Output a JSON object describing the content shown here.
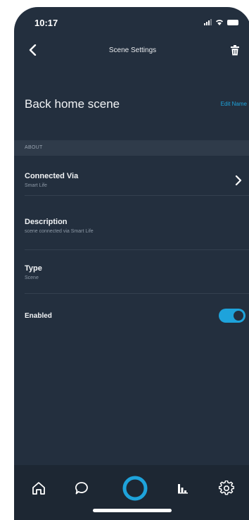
{
  "status_bar": {
    "time": "10:17"
  },
  "header": {
    "title": "Scene Settings",
    "back_icon": "chevron-left-icon",
    "delete_icon": "trash-icon"
  },
  "scene": {
    "name": "Back home scene",
    "edit_label": "Edit Name"
  },
  "section": {
    "title": "ABOUT"
  },
  "settings": {
    "connected_via": {
      "label": "Connected Via",
      "value": "Smart Life"
    },
    "description": {
      "label": "Description",
      "value": "scene connected via Smart Life"
    },
    "type": {
      "label": "Type",
      "value": "Scene"
    },
    "enabled": {
      "label": "Enabled",
      "value": true
    }
  },
  "tab_bar": {
    "items": [
      {
        "icon": "home-icon"
      },
      {
        "icon": "chat-icon"
      },
      {
        "icon": "alexa-icon"
      },
      {
        "icon": "activity-icon"
      },
      {
        "icon": "settings-gear-icon"
      }
    ]
  },
  "colors": {
    "background": "#232f3e",
    "accent": "#1ea3db",
    "tab_bar": "#1d2733"
  }
}
